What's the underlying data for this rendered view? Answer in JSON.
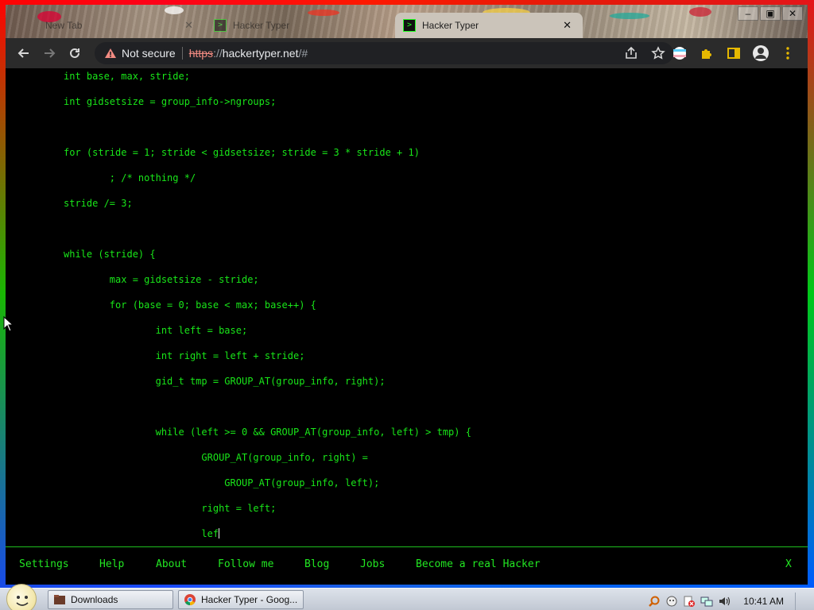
{
  "browser": {
    "tabs": [
      {
        "label": "New Tab",
        "active": false
      },
      {
        "label": "Hacker Typer",
        "active": false
      },
      {
        "label": "Hacker Typer",
        "active": true
      }
    ],
    "address": {
      "security_label": "Not secure",
      "url_scheme": "https",
      "url_sep": "://",
      "url_host": "hackertyper.net",
      "url_path": "/#"
    }
  },
  "code": {
    "color": "#19e619",
    "lines": [
      "int base, max, stride;",
      "int gidsetsize = group_info->ngroups;",
      "",
      "for (stride = 1; stride < gidsetsize; stride = 3 * stride + 1)",
      "        ; /* nothing */",
      "stride /= 3;",
      "",
      "while (stride) {",
      "        max = gidsetsize - stride;",
      "        for (base = 0; base < max; base++) {",
      "                int left = base;",
      "                int right = left + stride;",
      "                gid_t tmp = GROUP_AT(group_info, right);",
      "",
      "                while (left >= 0 && GROUP_AT(group_info, left) > tmp) {",
      "                        GROUP_AT(group_info, right) =",
      "                            GROUP_AT(group_info, left);",
      "                        right = left;",
      "                        lef"
    ]
  },
  "menu": {
    "items": [
      "Settings",
      "Help",
      "About",
      "Follow me",
      "Blog",
      "Jobs",
      "Become a real Hacker"
    ],
    "close_label": "X"
  },
  "taskbar": {
    "items": [
      "Downloads",
      "Hacker Typer - Goog..."
    ],
    "clock": "10:41 AM"
  }
}
